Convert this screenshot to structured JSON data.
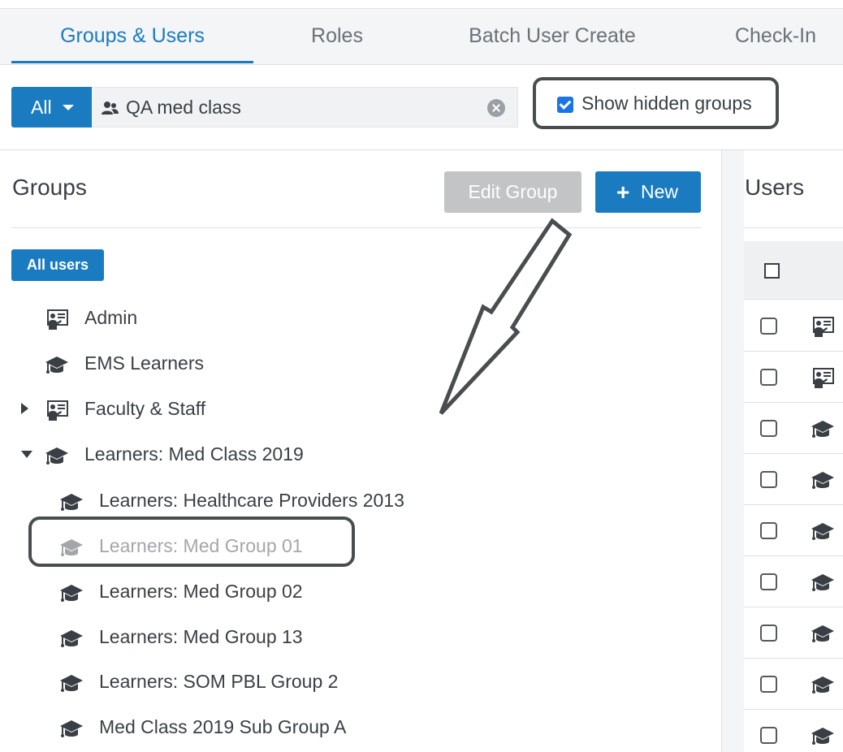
{
  "tabs": [
    {
      "label": "Groups & Users",
      "active": true
    },
    {
      "label": "Roles",
      "active": false
    },
    {
      "label": "Batch User Create",
      "active": false
    },
    {
      "label": "Check-In",
      "active": false
    }
  ],
  "filter": {
    "scope_label": "All",
    "search_value": "QA med class",
    "show_hidden_label": "Show hidden groups",
    "show_hidden_checked": true
  },
  "groups_panel": {
    "title": "Groups",
    "edit_group_label": "Edit Group",
    "new_label": "New",
    "all_users_label": "All users",
    "items": [
      {
        "label": "Admin",
        "icon": "instructor-board-icon",
        "level": 0,
        "toggle": "none",
        "hidden": false
      },
      {
        "label": "EMS Learners",
        "icon": "graduation-cap-icon",
        "level": 0,
        "toggle": "none",
        "hidden": false
      },
      {
        "label": "Faculty & Staff",
        "icon": "instructor-board-icon",
        "level": 0,
        "toggle": "collapsed",
        "hidden": false
      },
      {
        "label": "Learners: Med Class 2019",
        "icon": "graduation-cap-icon",
        "level": 0,
        "toggle": "expanded",
        "hidden": false
      },
      {
        "label": "Learners: Healthcare Providers 2013",
        "icon": "graduation-cap-icon",
        "level": 1,
        "toggle": "none",
        "hidden": false
      },
      {
        "label": "Learners: Med Group 01",
        "icon": "graduation-cap-icon",
        "level": 1,
        "toggle": "none",
        "hidden": true
      },
      {
        "label": "Learners: Med Group 02",
        "icon": "graduation-cap-icon",
        "level": 1,
        "toggle": "none",
        "hidden": false
      },
      {
        "label": "Learners: Med Group 13",
        "icon": "graduation-cap-icon",
        "level": 1,
        "toggle": "none",
        "hidden": false
      },
      {
        "label": "Learners: SOM PBL Group 2",
        "icon": "graduation-cap-icon",
        "level": 1,
        "toggle": "none",
        "hidden": false
      },
      {
        "label": "Med Class 2019 Sub Group A",
        "icon": "graduation-cap-icon",
        "level": 1,
        "toggle": "none",
        "hidden": false
      }
    ]
  },
  "users_panel": {
    "title": "Users",
    "rows": [
      {
        "icon": "instructor-board-icon"
      },
      {
        "icon": "instructor-board-icon"
      },
      {
        "icon": "graduation-cap-icon"
      },
      {
        "icon": "graduation-cap-icon"
      },
      {
        "icon": "graduation-cap-icon"
      },
      {
        "icon": "graduation-cap-icon"
      },
      {
        "icon": "graduation-cap-icon"
      },
      {
        "icon": "graduation-cap-icon"
      },
      {
        "icon": "graduation-cap-icon"
      }
    ]
  },
  "colors": {
    "accent": "#1b7bc1",
    "hidden_text": "#a3a7ab",
    "annotation": "#4a4d50"
  }
}
